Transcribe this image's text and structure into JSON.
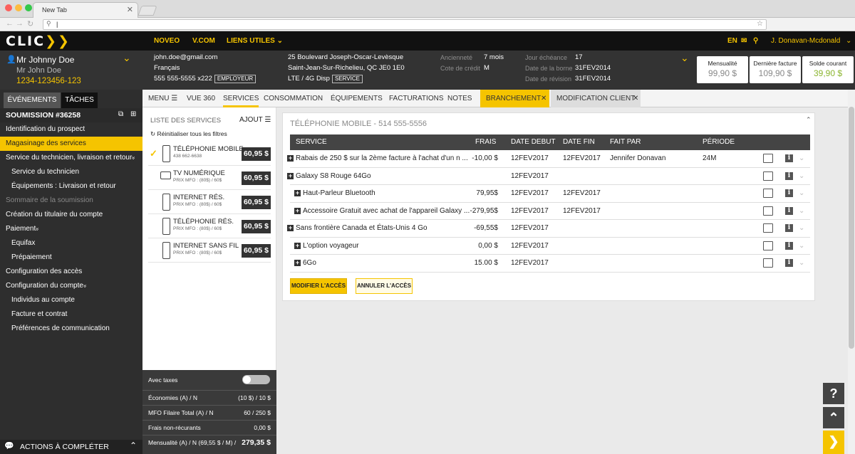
{
  "browser": {
    "tab_title": "New Tab",
    "address_value": "|"
  },
  "app": {
    "logo": "CLIC",
    "nav": [
      "NOVEO",
      "V.COM",
      "LIENS UTILES"
    ],
    "lang": "EN",
    "user": "J. Donavan-Mcdonald"
  },
  "customer": {
    "name": "Mr Johnny Doe",
    "alias": "Mr John Doe",
    "account": "1234-123456-123",
    "email": "john.doe@gmail.com",
    "language": "Français",
    "phone": "555 555-5555 x222",
    "phone_tag": "EMPLOYEUR",
    "address1": "25 Boulevard Joseph-Oscar-Levèsque",
    "address2": "Saint-Jean-Sur-Richelieu, QC JE0 1E0",
    "network": "LTE / 4G Disp",
    "network_tag": "SERVICE",
    "anciennete_label": "Ancienneté",
    "anciennete_value": "7 mois",
    "cote_label": "Cote de crédit",
    "cote_value": "M",
    "jour_label": "Jour échéance",
    "jour_value": "17",
    "borne_label": "Date de la borne",
    "borne_value": "31FEV2014",
    "revision_label": "Date de révision",
    "revision_value": "31FEV2014"
  },
  "kpis": [
    {
      "label": "Mensualité",
      "value": "99,90 $"
    },
    {
      "label": "Dernière facture",
      "value": "109,90 $"
    },
    {
      "label": "Solde courant",
      "value": "39,90 $"
    }
  ],
  "left": {
    "tabs": [
      "ÉVÉNEMENTS",
      "TÂCHES"
    ],
    "quote": "SOUMISSION #36258",
    "items": [
      {
        "label": "Identification du prospect"
      },
      {
        "label": "Magasinage des services"
      },
      {
        "label": "Service du technicien, livraison et retour"
      },
      {
        "label": "Service du technicien"
      },
      {
        "label": "Équipements : Livraison et retour"
      },
      {
        "label": "Sommaire de la soumission"
      },
      {
        "label": "Création du titulaire du compte"
      },
      {
        "label": "Paiement"
      },
      {
        "label": "Equifax"
      },
      {
        "label": "Prépaiement"
      },
      {
        "label": "Configuration des accès"
      },
      {
        "label": "Configuration du compte"
      },
      {
        "label": "Individus au compte"
      },
      {
        "label": "Facture et contrat"
      },
      {
        "label": "Préférences de communication"
      }
    ],
    "footer": "ACTIONS À COMPLÉTER"
  },
  "main_tabs": [
    "MENU",
    "VUE 360",
    "SERVICES",
    "CONSOMMATION",
    "ÉQUIPEMENTS",
    "FACTURATIONS",
    "NOTES",
    "BRANCHEMENT",
    "MODIFICATION CLIENT"
  ],
  "services": {
    "header": "LISTE DES SERVICES",
    "add": "AJOUT",
    "reset": "Réinitialiser tous les filtres",
    "items": [
      {
        "name": "TÉLÉPHONIE MOBILE",
        "sub": "438 662-6638",
        "price": "60,95 $"
      },
      {
        "name": "TV NUMÉRIQUE",
        "sub": "PRIX MFO : (80$) / 60$",
        "price": "60,95 $"
      },
      {
        "name": "INTERNET RÉS.",
        "sub": "PRIX MFO : (80$) / 60$",
        "price": "60,95 $"
      },
      {
        "name": "TÉLÉPHONIE RÉS.",
        "sub": "PRIX MFO : (80$) / 60$",
        "price": "60,95 $"
      },
      {
        "name": "INTERNET SANS FIL",
        "sub": "PRIX MFO : (80$) / 60$",
        "price": "60,95 $"
      }
    ]
  },
  "totals": {
    "taxes_label": "Avec taxes",
    "rows": [
      {
        "label": "Économies (A) / N",
        "value": "(10 $) / 10 $"
      },
      {
        "label": "MFO Filaire Total  (A) / N",
        "value": "60 / 250 $"
      },
      {
        "label": "Frais non-récurants",
        "value": "0,00 $"
      },
      {
        "label": "Mensualité (A) / N (69,55 $ / M) /",
        "value": "279,35 $"
      }
    ]
  },
  "panel": {
    "title": "TÉLÉPHONIE MOBILE - 514 555-5556",
    "columns": [
      "SERVICE",
      "FRAIS",
      "DATE DEBUT",
      "DATE FIN",
      "FAIT PAR",
      "PÉRIODE"
    ],
    "rows": [
      {
        "service": "Rabais de 250 $ sur la 2ème facture à l'achat d'un n ...",
        "frais": "-10,00 $",
        "debut": "12FEV2017",
        "fin": "12FEV2017",
        "par": "Jennifer Donavan",
        "periode": "24M"
      },
      {
        "service": "Galaxy S8 Rouge 64Go",
        "frais": "",
        "debut": "12FEV2017",
        "fin": "",
        "par": "",
        "periode": ""
      },
      {
        "service": "Haut-Parleur Bluetooth",
        "frais": "79,95$",
        "debut": "12FEV2017",
        "fin": "12FEV2017",
        "par": "",
        "periode": ""
      },
      {
        "service": "Accessoire Gratuit avec achat de l'appareil Galaxy ...",
        "frais": "-279,95$",
        "debut": "12FEV2017",
        "fin": "12FEV2017",
        "par": "",
        "periode": ""
      },
      {
        "service": "Sans frontière Canada et États-Unis 4 Go",
        "frais": "-69,55$",
        "debut": "12FEV2017",
        "fin": "",
        "par": "",
        "periode": ""
      },
      {
        "service": "L'option voyageur",
        "frais": "0,00 $",
        "debut": "12FEV2017",
        "fin": "",
        "par": "",
        "periode": ""
      },
      {
        "service": "6Go",
        "frais": "15.00 $",
        "debut": "12FEV2017",
        "fin": "",
        "par": "",
        "periode": ""
      }
    ],
    "btn_modify": "MODIFIER L'ACCÈS",
    "btn_cancel": "ANNULER L'ACCÈS"
  },
  "colors": {
    "accent": "#f5c400",
    "dark": "#2e2e2e"
  }
}
